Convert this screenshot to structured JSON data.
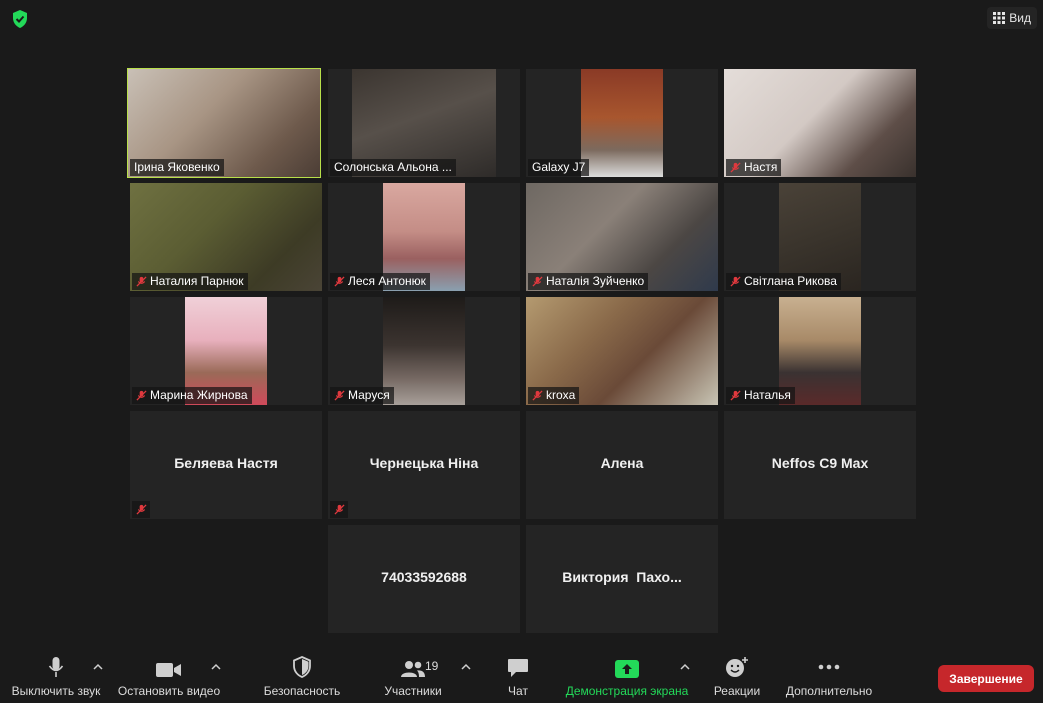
{
  "header": {
    "view_label": "Вид"
  },
  "video_tiles": [
    {
      "name": "Ірина Яковенко",
      "muted": false,
      "active": true
    },
    {
      "name": "Солонська Альона ...",
      "muted": false
    },
    {
      "name": "Galaxy J7",
      "muted": false
    },
    {
      "name": "Настя",
      "muted": true
    },
    {
      "name": "Наталия Парнюк",
      "muted": true
    },
    {
      "name": "Леся Антонюк",
      "muted": true
    },
    {
      "name": "Наталія Зуйченко",
      "muted": true
    },
    {
      "name": "Світлана Рикова",
      "muted": true
    },
    {
      "name": "Марина Жирнова",
      "muted": true
    },
    {
      "name": "Маруся",
      "muted": true
    },
    {
      "name": "kroxa",
      "muted": true
    },
    {
      "name": "Наталья",
      "muted": true
    }
  ],
  "name_tiles": [
    {
      "name": "Беляева Настя",
      "muted": true
    },
    {
      "name": "Чернецька Ніна",
      "muted": true
    },
    {
      "name": "Алена",
      "muted": false
    },
    {
      "name": "Neffos C9 Max",
      "muted": false
    },
    {
      "name": "74033592688",
      "muted": false
    },
    {
      "name": "Виктория  Пахо...",
      "muted": false
    }
  ],
  "toolbar": {
    "mute_label": "Выключить звук",
    "video_label": "Остановить видео",
    "security_label": "Безопасность",
    "participants_label": "Участники",
    "participants_count": "19",
    "chat_label": "Чат",
    "share_label": "Демонстрация экрана",
    "reactions_label": "Реакции",
    "more_label": "Дополнительно",
    "end_label": "Завершение"
  },
  "colors": {
    "background": "#1a1a1a",
    "tile": "#242424",
    "active_speaker": "#b8e04a",
    "share_green": "#23d959",
    "end_red": "#c6272b",
    "mute_red": "#e0393e"
  }
}
